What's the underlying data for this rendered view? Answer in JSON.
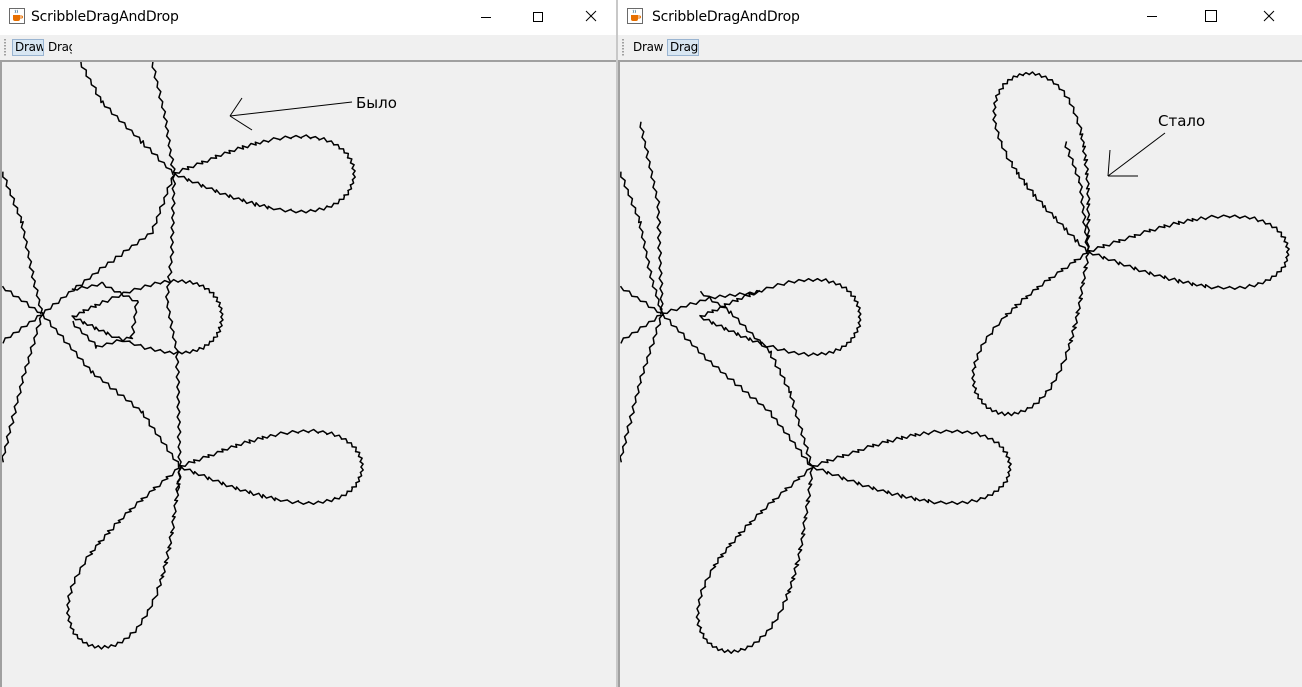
{
  "left_window": {
    "title": "ScribbleDragAndDrop",
    "tools": [
      {
        "label": "Draw",
        "selected": true
      },
      {
        "label": "Drag",
        "selected": false
      }
    ],
    "annotation": "Было"
  },
  "right_window": {
    "title": "ScribbleDragAndDrop",
    "tools": [
      {
        "label": "Draw",
        "selected": false
      },
      {
        "label": "Drag",
        "selected": true
      }
    ],
    "annotation": "Стало"
  },
  "icons": {
    "app": "java-cup-icon",
    "minimize": "minimize-icon",
    "maximize": "maximize-icon",
    "close": "close-icon"
  },
  "colors": {
    "selected_tool_bg": "#d8e6f2",
    "selected_tool_border": "#99b4d1",
    "canvas_bg": "#f0f0f0",
    "stroke": "#000000"
  }
}
